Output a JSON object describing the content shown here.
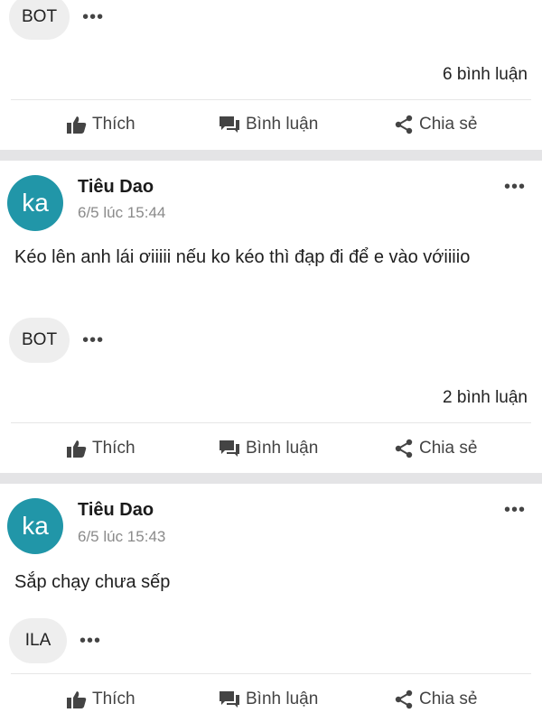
{
  "actions": {
    "like": "Thích",
    "comment": "Bình luận",
    "share": "Chia sẻ"
  },
  "more_label": "•••",
  "post_top": {
    "tag": "BOT",
    "comments": "6 bình luận"
  },
  "post_2": {
    "avatar": "ka",
    "author": "Tiêu Dao",
    "time": "6/5 lúc 15:44",
    "text": "Kéo lên anh lái ơiiiii nếu ko kéo thì đạp đi để e vào vớiiiio",
    "tag": "BOT",
    "comments": "2 bình luận"
  },
  "post_3": {
    "avatar": "ka",
    "author": "Tiêu Dao",
    "time": "6/5 lúc 15:43",
    "text": "Sắp chạy chưa sếp",
    "tag": "ILA"
  },
  "colors": {
    "avatar": "#2196a8",
    "separator": "#e4e4e6",
    "tag_bg": "#eeeeee"
  }
}
